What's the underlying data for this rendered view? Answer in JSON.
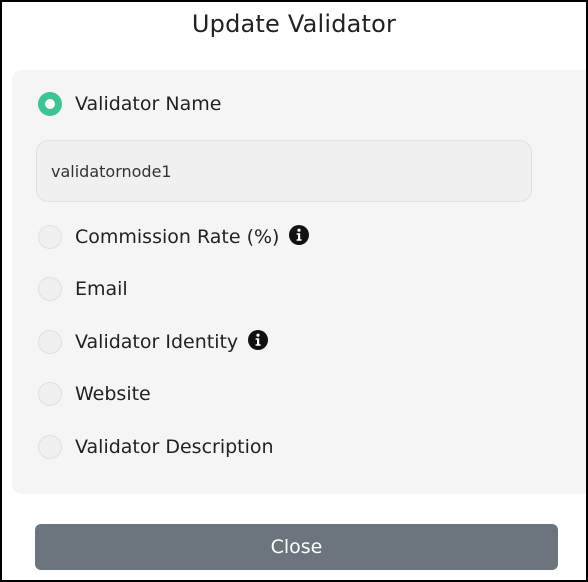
{
  "modal": {
    "title": "Update Validator",
    "close_label": "Close"
  },
  "options": [
    {
      "label": "Validator Name",
      "selected": true,
      "has_info": false
    },
    {
      "label": "Commission Rate (%)",
      "selected": false,
      "has_info": true
    },
    {
      "label": "Email",
      "selected": false,
      "has_info": false
    },
    {
      "label": "Validator Identity",
      "selected": false,
      "has_info": true
    },
    {
      "label": "Website",
      "selected": false,
      "has_info": false
    },
    {
      "label": "Validator Description",
      "selected": false,
      "has_info": false
    }
  ],
  "name_input": {
    "value": "validatornode1"
  },
  "colors": {
    "accent": "#3dc492",
    "close_button": "#6c757d",
    "panel_bg": "#f5f5f5"
  },
  "icons": {
    "info": "info-circle-icon"
  }
}
